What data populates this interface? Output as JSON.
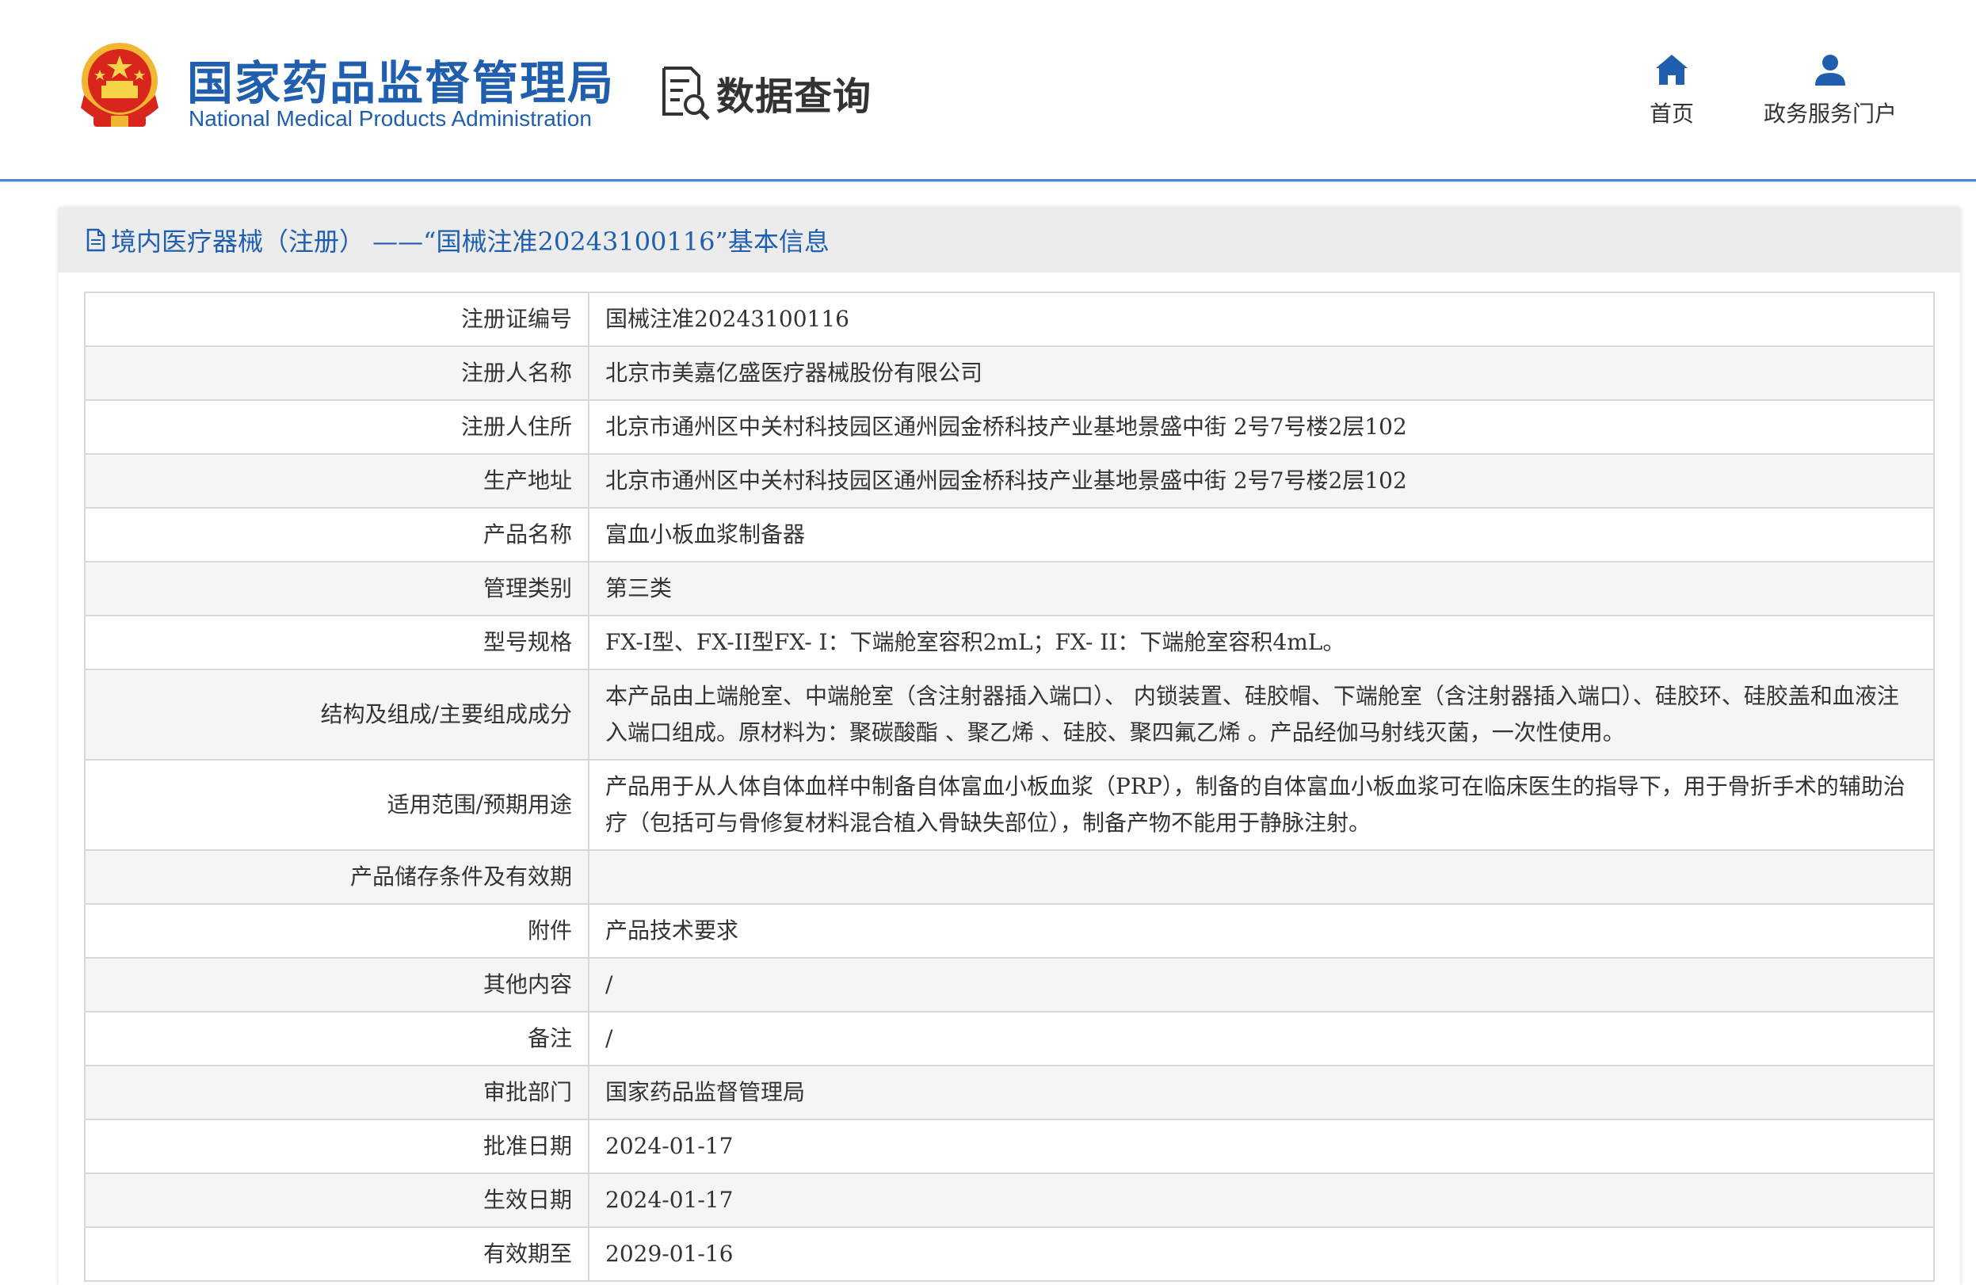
{
  "header": {
    "logo_cn": "国家药品监督管理局",
    "logo_en": "National Medical Products Administration",
    "query_label": "数据查询",
    "nav": [
      {
        "label": "首页",
        "icon": "home-icon"
      },
      {
        "label": "政务服务门户",
        "icon": "user-icon"
      }
    ]
  },
  "colors": {
    "brand": "#1f5fae",
    "border": "#d9d9d9",
    "title_bg": "#ececec"
  },
  "panel": {
    "title": "境内医疗器械（注册） ——“国械注准20243100116”基本信息",
    "rows": [
      {
        "label": "注册证编号",
        "value": "国械注准20243100116"
      },
      {
        "label": "注册人名称",
        "value": "北京市美嘉亿盛医疗器械股份有限公司"
      },
      {
        "label": "注册人住所",
        "value": "北京市通州区中关村科技园区通州园金桥科技产业基地景盛中街 2号7号楼2层102"
      },
      {
        "label": "生产地址",
        "value": "北京市通州区中关村科技园区通州园金桥科技产业基地景盛中街 2号7号楼2层102"
      },
      {
        "label": "产品名称",
        "value": "富血小板血浆制备器"
      },
      {
        "label": "管理类别",
        "value": "第三类"
      },
      {
        "label": "型号规格",
        "value": "FX-I型、FX-II型FX- I：下端舱室容积2mL；FX- II：下端舱室容积4mL。"
      },
      {
        "label": "结构及组成/主要组成成分",
        "value": "本产品由上端舱室、中端舱室（含注射器插入端口）、 内锁装置、硅胶帽、下端舱室（含注射器插入端口）、硅胶环、硅胶盖和血液注入端口组成。原材料为：聚碳酸酯 、聚乙烯 、硅胶、聚四氟乙烯 。产品经伽马射线灭菌，一次性使用。"
      },
      {
        "label": "适用范围/预期用途",
        "value": "产品用于从人体自体血样中制备自体富血小板血浆（PRP），制备的自体富血小板血浆可在临床医生的指导下，用于骨折手术的辅助治疗（包括可与骨修复材料混合植入骨缺失部位），制备产物不能用于静脉注射。"
      },
      {
        "label": "产品储存条件及有效期",
        "value": ""
      },
      {
        "label": "附件",
        "value": "产品技术要求"
      },
      {
        "label": "其他内容",
        "value": "/"
      },
      {
        "label": "备注",
        "value": "/"
      },
      {
        "label": "审批部门",
        "value": "国家药品监督管理局"
      },
      {
        "label": "批准日期",
        "value": "2024-01-17"
      },
      {
        "label": "生效日期",
        "value": "2024-01-17"
      },
      {
        "label": "有效期至",
        "value": "2029-01-16"
      }
    ]
  }
}
